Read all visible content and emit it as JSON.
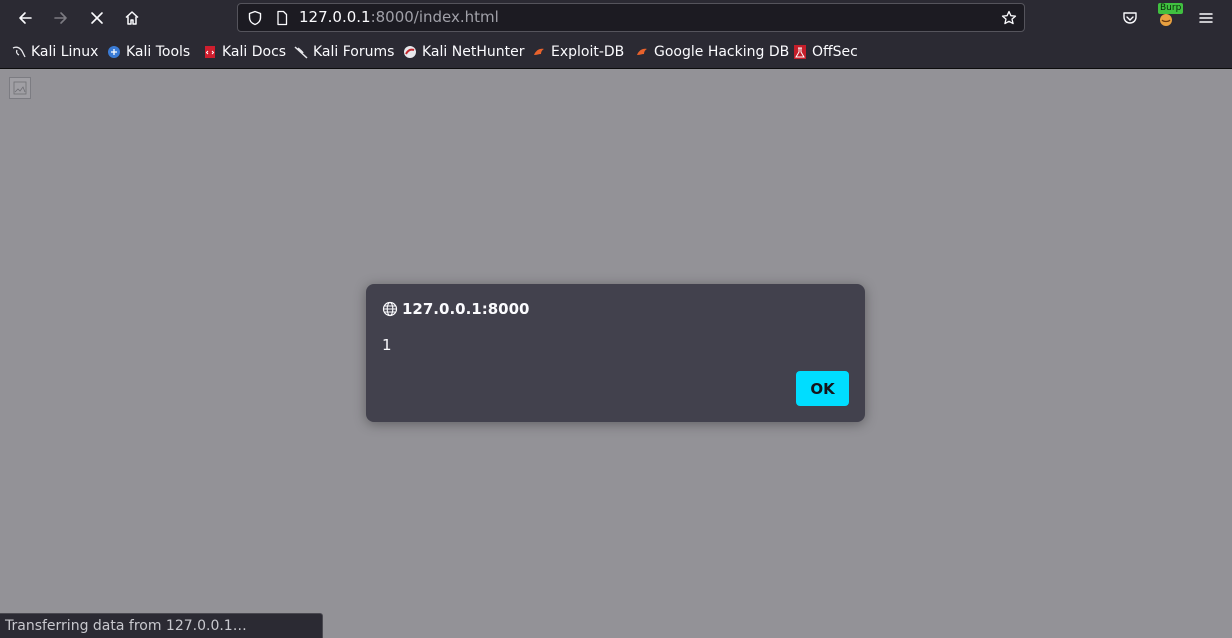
{
  "url": {
    "host": "127.0.0.1",
    "rest": ":8000/index.html"
  },
  "toolbar": {
    "burp_badge": "Burp"
  },
  "bookmarks": [
    {
      "label": "Kali Linux",
      "icon": "kali-dragon-icon"
    },
    {
      "label": "Kali Tools",
      "icon": "kali-tools-icon"
    },
    {
      "label": "Kali Docs",
      "icon": "kali-docs-icon"
    },
    {
      "label": "Kali Forums",
      "icon": "kali-forums-icon"
    },
    {
      "label": "Kali NetHunter",
      "icon": "nethunter-icon"
    },
    {
      "label": "Exploit-DB",
      "icon": "exploit-db-icon"
    },
    {
      "label": "Google Hacking DB",
      "icon": "ghdb-icon"
    },
    {
      "label": "OffSec",
      "icon": "offsec-icon"
    }
  ],
  "dialog": {
    "origin": "127.0.0.1:8000",
    "message": "1",
    "ok_label": "OK"
  },
  "status": {
    "text": "Transferring data from 127.0.0.1…"
  },
  "colors": {
    "accent": "#00ddff",
    "toolbar": "#2b2a33",
    "page": "#939297",
    "dialog": "#42414d"
  }
}
